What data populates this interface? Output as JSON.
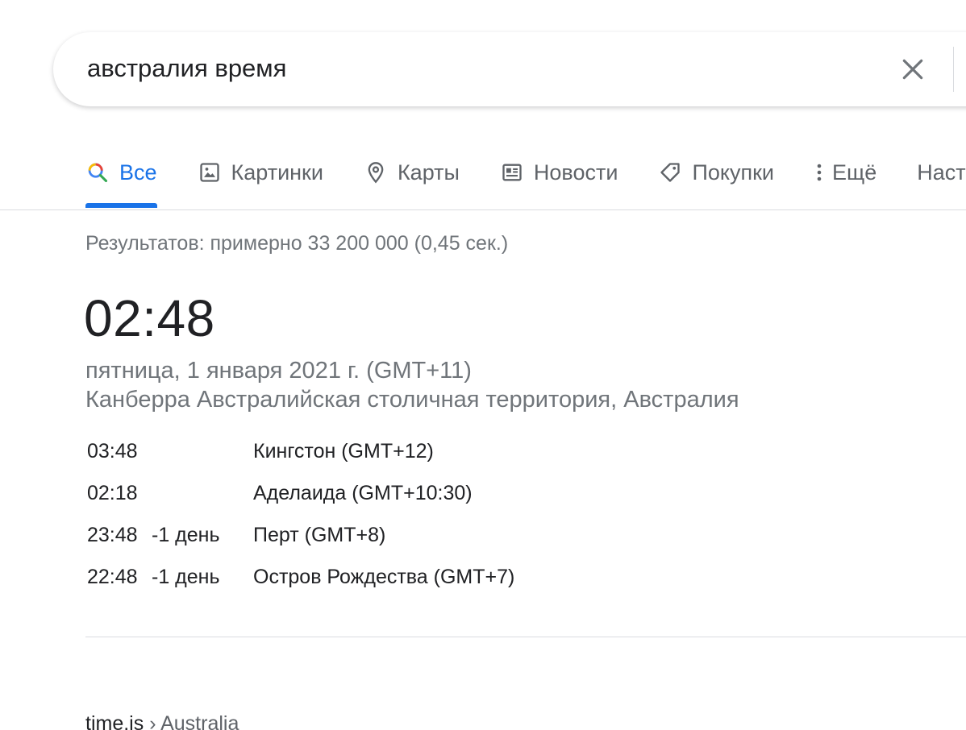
{
  "search": {
    "query": "австралия время"
  },
  "tabs": [
    {
      "label": "Все",
      "icon": "search-icon"
    },
    {
      "label": "Картинки",
      "icon": "image-icon"
    },
    {
      "label": "Карты",
      "icon": "map-pin-icon"
    },
    {
      "label": "Новости",
      "icon": "news-icon"
    },
    {
      "label": "Покупки",
      "icon": "tag-icon"
    },
    {
      "label": "Ещё",
      "icon": "more-vert-icon"
    },
    {
      "label": "Наст"
    }
  ],
  "results": {
    "stats": "Результатов: примерно 33 200 000 (0,45 сек.)"
  },
  "time_card": {
    "time": "02:48",
    "date": "пятница, 1 января 2021 г. (GMT+11)",
    "location": "Канберра Австралийская столичная территория, Австралия",
    "zones": [
      {
        "time": "03:48",
        "offset": "",
        "name": "Кингстон (GMT+12)"
      },
      {
        "time": "02:18",
        "offset": "",
        "name": "Аделаида (GMT+10:30)"
      },
      {
        "time": "23:48",
        "offset": "-1 день",
        "name": "Перт (GMT+8)"
      },
      {
        "time": "22:48",
        "offset": "-1 день",
        "name": "Остров Рождества (GMT+7)"
      }
    ]
  },
  "next_result": {
    "site": "time.is",
    "separator": "›",
    "crumb": "Australia"
  },
  "colors": {
    "accent": "#1a73e8",
    "muted": "#70757a",
    "text": "#202124"
  }
}
